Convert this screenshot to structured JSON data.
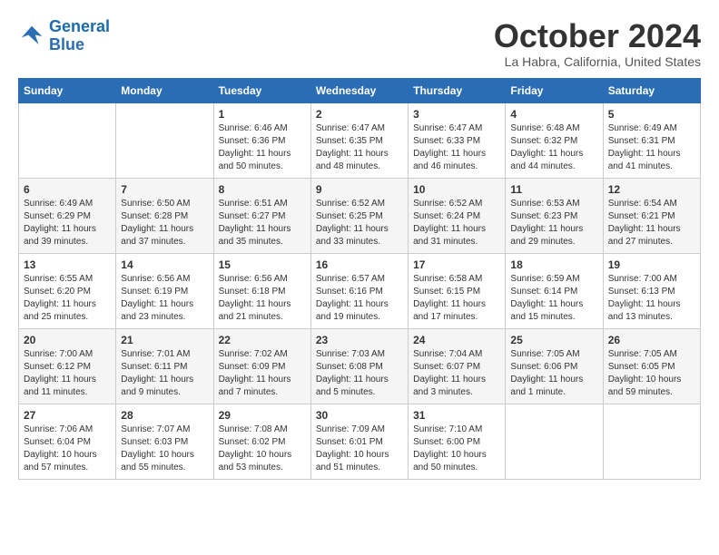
{
  "header": {
    "logo_line1": "General",
    "logo_line2": "Blue",
    "month": "October 2024",
    "location": "La Habra, California, United States"
  },
  "weekdays": [
    "Sunday",
    "Monday",
    "Tuesday",
    "Wednesday",
    "Thursday",
    "Friday",
    "Saturday"
  ],
  "weeks": [
    [
      {
        "day": "",
        "info": ""
      },
      {
        "day": "",
        "info": ""
      },
      {
        "day": "1",
        "info": "Sunrise: 6:46 AM\nSunset: 6:36 PM\nDaylight: 11 hours\nand 50 minutes."
      },
      {
        "day": "2",
        "info": "Sunrise: 6:47 AM\nSunset: 6:35 PM\nDaylight: 11 hours\nand 48 minutes."
      },
      {
        "day": "3",
        "info": "Sunrise: 6:47 AM\nSunset: 6:33 PM\nDaylight: 11 hours\nand 46 minutes."
      },
      {
        "day": "4",
        "info": "Sunrise: 6:48 AM\nSunset: 6:32 PM\nDaylight: 11 hours\nand 44 minutes."
      },
      {
        "day": "5",
        "info": "Sunrise: 6:49 AM\nSunset: 6:31 PM\nDaylight: 11 hours\nand 41 minutes."
      }
    ],
    [
      {
        "day": "6",
        "info": "Sunrise: 6:49 AM\nSunset: 6:29 PM\nDaylight: 11 hours\nand 39 minutes."
      },
      {
        "day": "7",
        "info": "Sunrise: 6:50 AM\nSunset: 6:28 PM\nDaylight: 11 hours\nand 37 minutes."
      },
      {
        "day": "8",
        "info": "Sunrise: 6:51 AM\nSunset: 6:27 PM\nDaylight: 11 hours\nand 35 minutes."
      },
      {
        "day": "9",
        "info": "Sunrise: 6:52 AM\nSunset: 6:25 PM\nDaylight: 11 hours\nand 33 minutes."
      },
      {
        "day": "10",
        "info": "Sunrise: 6:52 AM\nSunset: 6:24 PM\nDaylight: 11 hours\nand 31 minutes."
      },
      {
        "day": "11",
        "info": "Sunrise: 6:53 AM\nSunset: 6:23 PM\nDaylight: 11 hours\nand 29 minutes."
      },
      {
        "day": "12",
        "info": "Sunrise: 6:54 AM\nSunset: 6:21 PM\nDaylight: 11 hours\nand 27 minutes."
      }
    ],
    [
      {
        "day": "13",
        "info": "Sunrise: 6:55 AM\nSunset: 6:20 PM\nDaylight: 11 hours\nand 25 minutes."
      },
      {
        "day": "14",
        "info": "Sunrise: 6:56 AM\nSunset: 6:19 PM\nDaylight: 11 hours\nand 23 minutes."
      },
      {
        "day": "15",
        "info": "Sunrise: 6:56 AM\nSunset: 6:18 PM\nDaylight: 11 hours\nand 21 minutes."
      },
      {
        "day": "16",
        "info": "Sunrise: 6:57 AM\nSunset: 6:16 PM\nDaylight: 11 hours\nand 19 minutes."
      },
      {
        "day": "17",
        "info": "Sunrise: 6:58 AM\nSunset: 6:15 PM\nDaylight: 11 hours\nand 17 minutes."
      },
      {
        "day": "18",
        "info": "Sunrise: 6:59 AM\nSunset: 6:14 PM\nDaylight: 11 hours\nand 15 minutes."
      },
      {
        "day": "19",
        "info": "Sunrise: 7:00 AM\nSunset: 6:13 PM\nDaylight: 11 hours\nand 13 minutes."
      }
    ],
    [
      {
        "day": "20",
        "info": "Sunrise: 7:00 AM\nSunset: 6:12 PM\nDaylight: 11 hours\nand 11 minutes."
      },
      {
        "day": "21",
        "info": "Sunrise: 7:01 AM\nSunset: 6:11 PM\nDaylight: 11 hours\nand 9 minutes."
      },
      {
        "day": "22",
        "info": "Sunrise: 7:02 AM\nSunset: 6:09 PM\nDaylight: 11 hours\nand 7 minutes."
      },
      {
        "day": "23",
        "info": "Sunrise: 7:03 AM\nSunset: 6:08 PM\nDaylight: 11 hours\nand 5 minutes."
      },
      {
        "day": "24",
        "info": "Sunrise: 7:04 AM\nSunset: 6:07 PM\nDaylight: 11 hours\nand 3 minutes."
      },
      {
        "day": "25",
        "info": "Sunrise: 7:05 AM\nSunset: 6:06 PM\nDaylight: 11 hours\nand 1 minute."
      },
      {
        "day": "26",
        "info": "Sunrise: 7:05 AM\nSunset: 6:05 PM\nDaylight: 10 hours\nand 59 minutes."
      }
    ],
    [
      {
        "day": "27",
        "info": "Sunrise: 7:06 AM\nSunset: 6:04 PM\nDaylight: 10 hours\nand 57 minutes."
      },
      {
        "day": "28",
        "info": "Sunrise: 7:07 AM\nSunset: 6:03 PM\nDaylight: 10 hours\nand 55 minutes."
      },
      {
        "day": "29",
        "info": "Sunrise: 7:08 AM\nSunset: 6:02 PM\nDaylight: 10 hours\nand 53 minutes."
      },
      {
        "day": "30",
        "info": "Sunrise: 7:09 AM\nSunset: 6:01 PM\nDaylight: 10 hours\nand 51 minutes."
      },
      {
        "day": "31",
        "info": "Sunrise: 7:10 AM\nSunset: 6:00 PM\nDaylight: 10 hours\nand 50 minutes."
      },
      {
        "day": "",
        "info": ""
      },
      {
        "day": "",
        "info": ""
      }
    ]
  ]
}
